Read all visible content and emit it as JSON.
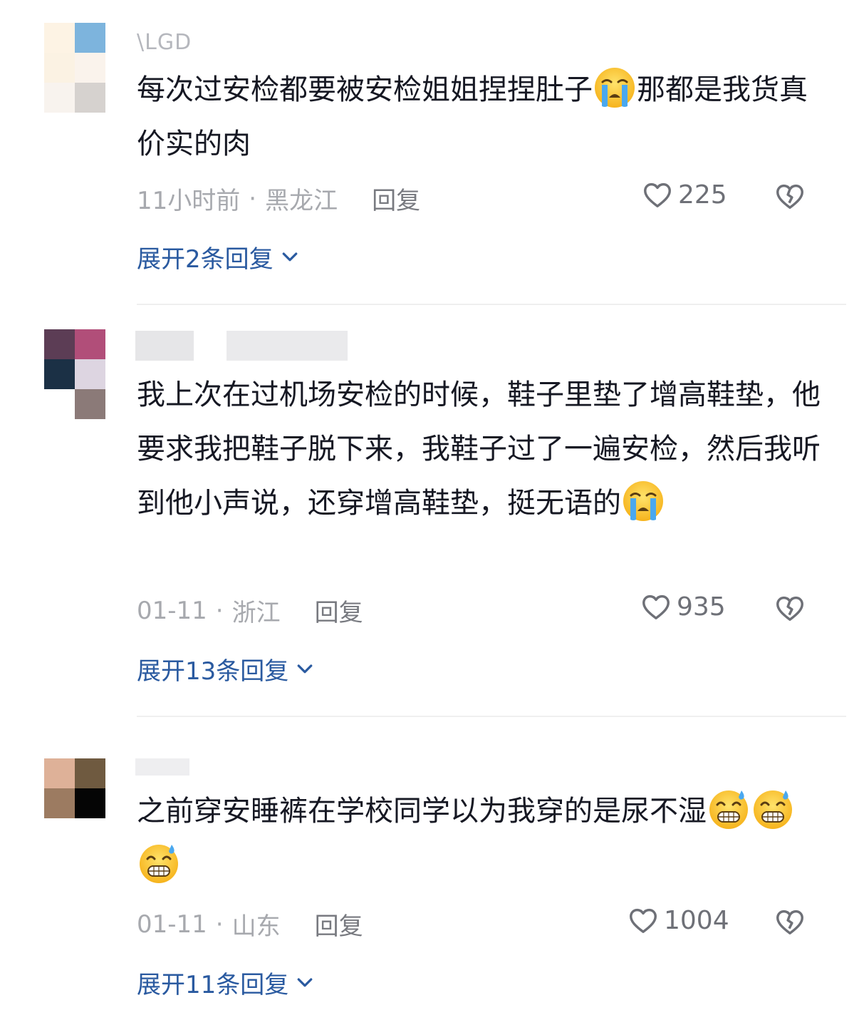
{
  "comments": [
    {
      "username": "\\LGD",
      "text_before": "每次过安检都要被安检姐姐捏捏肚子",
      "text_after": "那都是我货真价实的肉",
      "emoji": "loudly-crying-face",
      "time": "11小时前",
      "location": "黑龙江",
      "reply_label": "回复",
      "likes": "225",
      "expand_label": "展开2条回复"
    },
    {
      "username": "",
      "text_before": "我上次在过机场安检的时候，鞋子里垫了增高鞋垫，他要求我把鞋子脱下来，我鞋子过了一遍安检，然后我听到他小声说，还穿增高鞋垫，挺无语的",
      "text_after": "",
      "emoji": "loudly-crying-face",
      "time": "01-11",
      "location": "浙江",
      "reply_label": "回复",
      "likes": "935",
      "expand_label": "展开13条回复"
    },
    {
      "username": "",
      "text_before": "之前穿安睡裤在学校同学以为我穿的是尿不湿",
      "text_after": "",
      "emoji": "grinning-face-with-sweat",
      "time": "01-11",
      "location": "山东",
      "reply_label": "回复",
      "likes": "1004",
      "expand_label": "展开11条回复"
    }
  ],
  "separator": "·",
  "colors": {
    "text": "#161823",
    "meta": "#a7a9ae",
    "expand": "#2a5aa0",
    "icon": "#6e7077"
  }
}
